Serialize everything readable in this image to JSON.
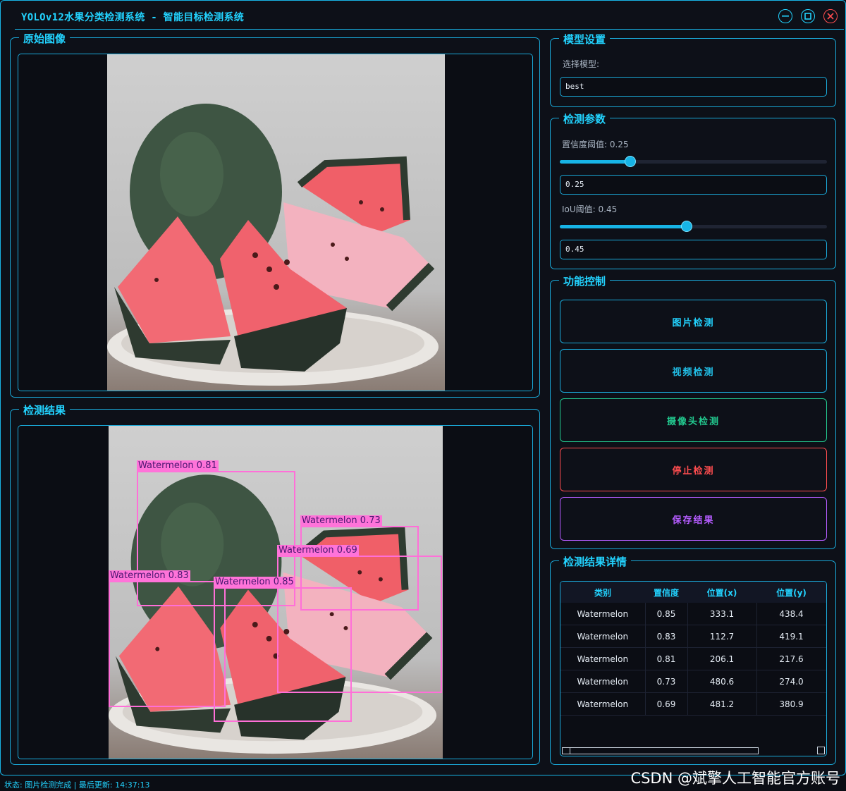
{
  "window": {
    "title": "YOLOv12水果分类检测系统 - 智能目标检测系统",
    "minimize_icon": "minimize-icon",
    "maximize_icon": "maximize-icon",
    "close_icon": "close-icon"
  },
  "original_panel": {
    "title": "原始图像"
  },
  "result_panel": {
    "title": "检测结果"
  },
  "model_settings": {
    "title": "模型设置",
    "select_label": "选择模型:",
    "selected_model": "best"
  },
  "detection_params": {
    "title": "检测参数",
    "confidence_label": "置信度阈值: 0.25",
    "confidence_value": "0.25",
    "confidence_level": 0.25,
    "iou_label": "IoU阈值: 0.45",
    "iou_value": "0.45",
    "iou_level": 0.45
  },
  "controls": {
    "title": "功能控制",
    "image_detect": "图片检测",
    "video_detect": "视频检测",
    "camera_detect": "摄像头检测",
    "stop_detect": "停止检测",
    "save_results": "保存结果"
  },
  "results_table": {
    "title": "检测结果详情",
    "headers": [
      "类别",
      "置信度",
      "位置(x)",
      "位置(y)"
    ],
    "rows": [
      [
        "Watermelon",
        "0.85",
        "333.1",
        "438.4"
      ],
      [
        "Watermelon",
        "0.83",
        "112.7",
        "419.1"
      ],
      [
        "Watermelon",
        "0.81",
        "206.1",
        "217.6"
      ],
      [
        "Watermelon",
        "0.73",
        "480.6",
        "274.0"
      ],
      [
        "Watermelon",
        "0.69",
        "481.2",
        "380.9"
      ]
    ]
  },
  "detections": [
    {
      "label": "Watermelon 0.81"
    },
    {
      "label": "Watermelon 0.73"
    },
    {
      "label": "Watermelon 0.69"
    },
    {
      "label": "Watermelon 0.83"
    },
    {
      "label": "Watermelon 0.85"
    }
  ],
  "status_bar": {
    "text": "状态: 图片检测完成 | 最后更新: 14:37:13"
  },
  "watermark": "CSDN @斌擎人工智能官方账号",
  "colors": {
    "accent": "#22d3ff",
    "border": "#1aa9d9",
    "camera_button": "#22c98f",
    "stop_button": "#ff4d4f",
    "save_button": "#b55cff",
    "detection_box": "#ff6fd8"
  }
}
